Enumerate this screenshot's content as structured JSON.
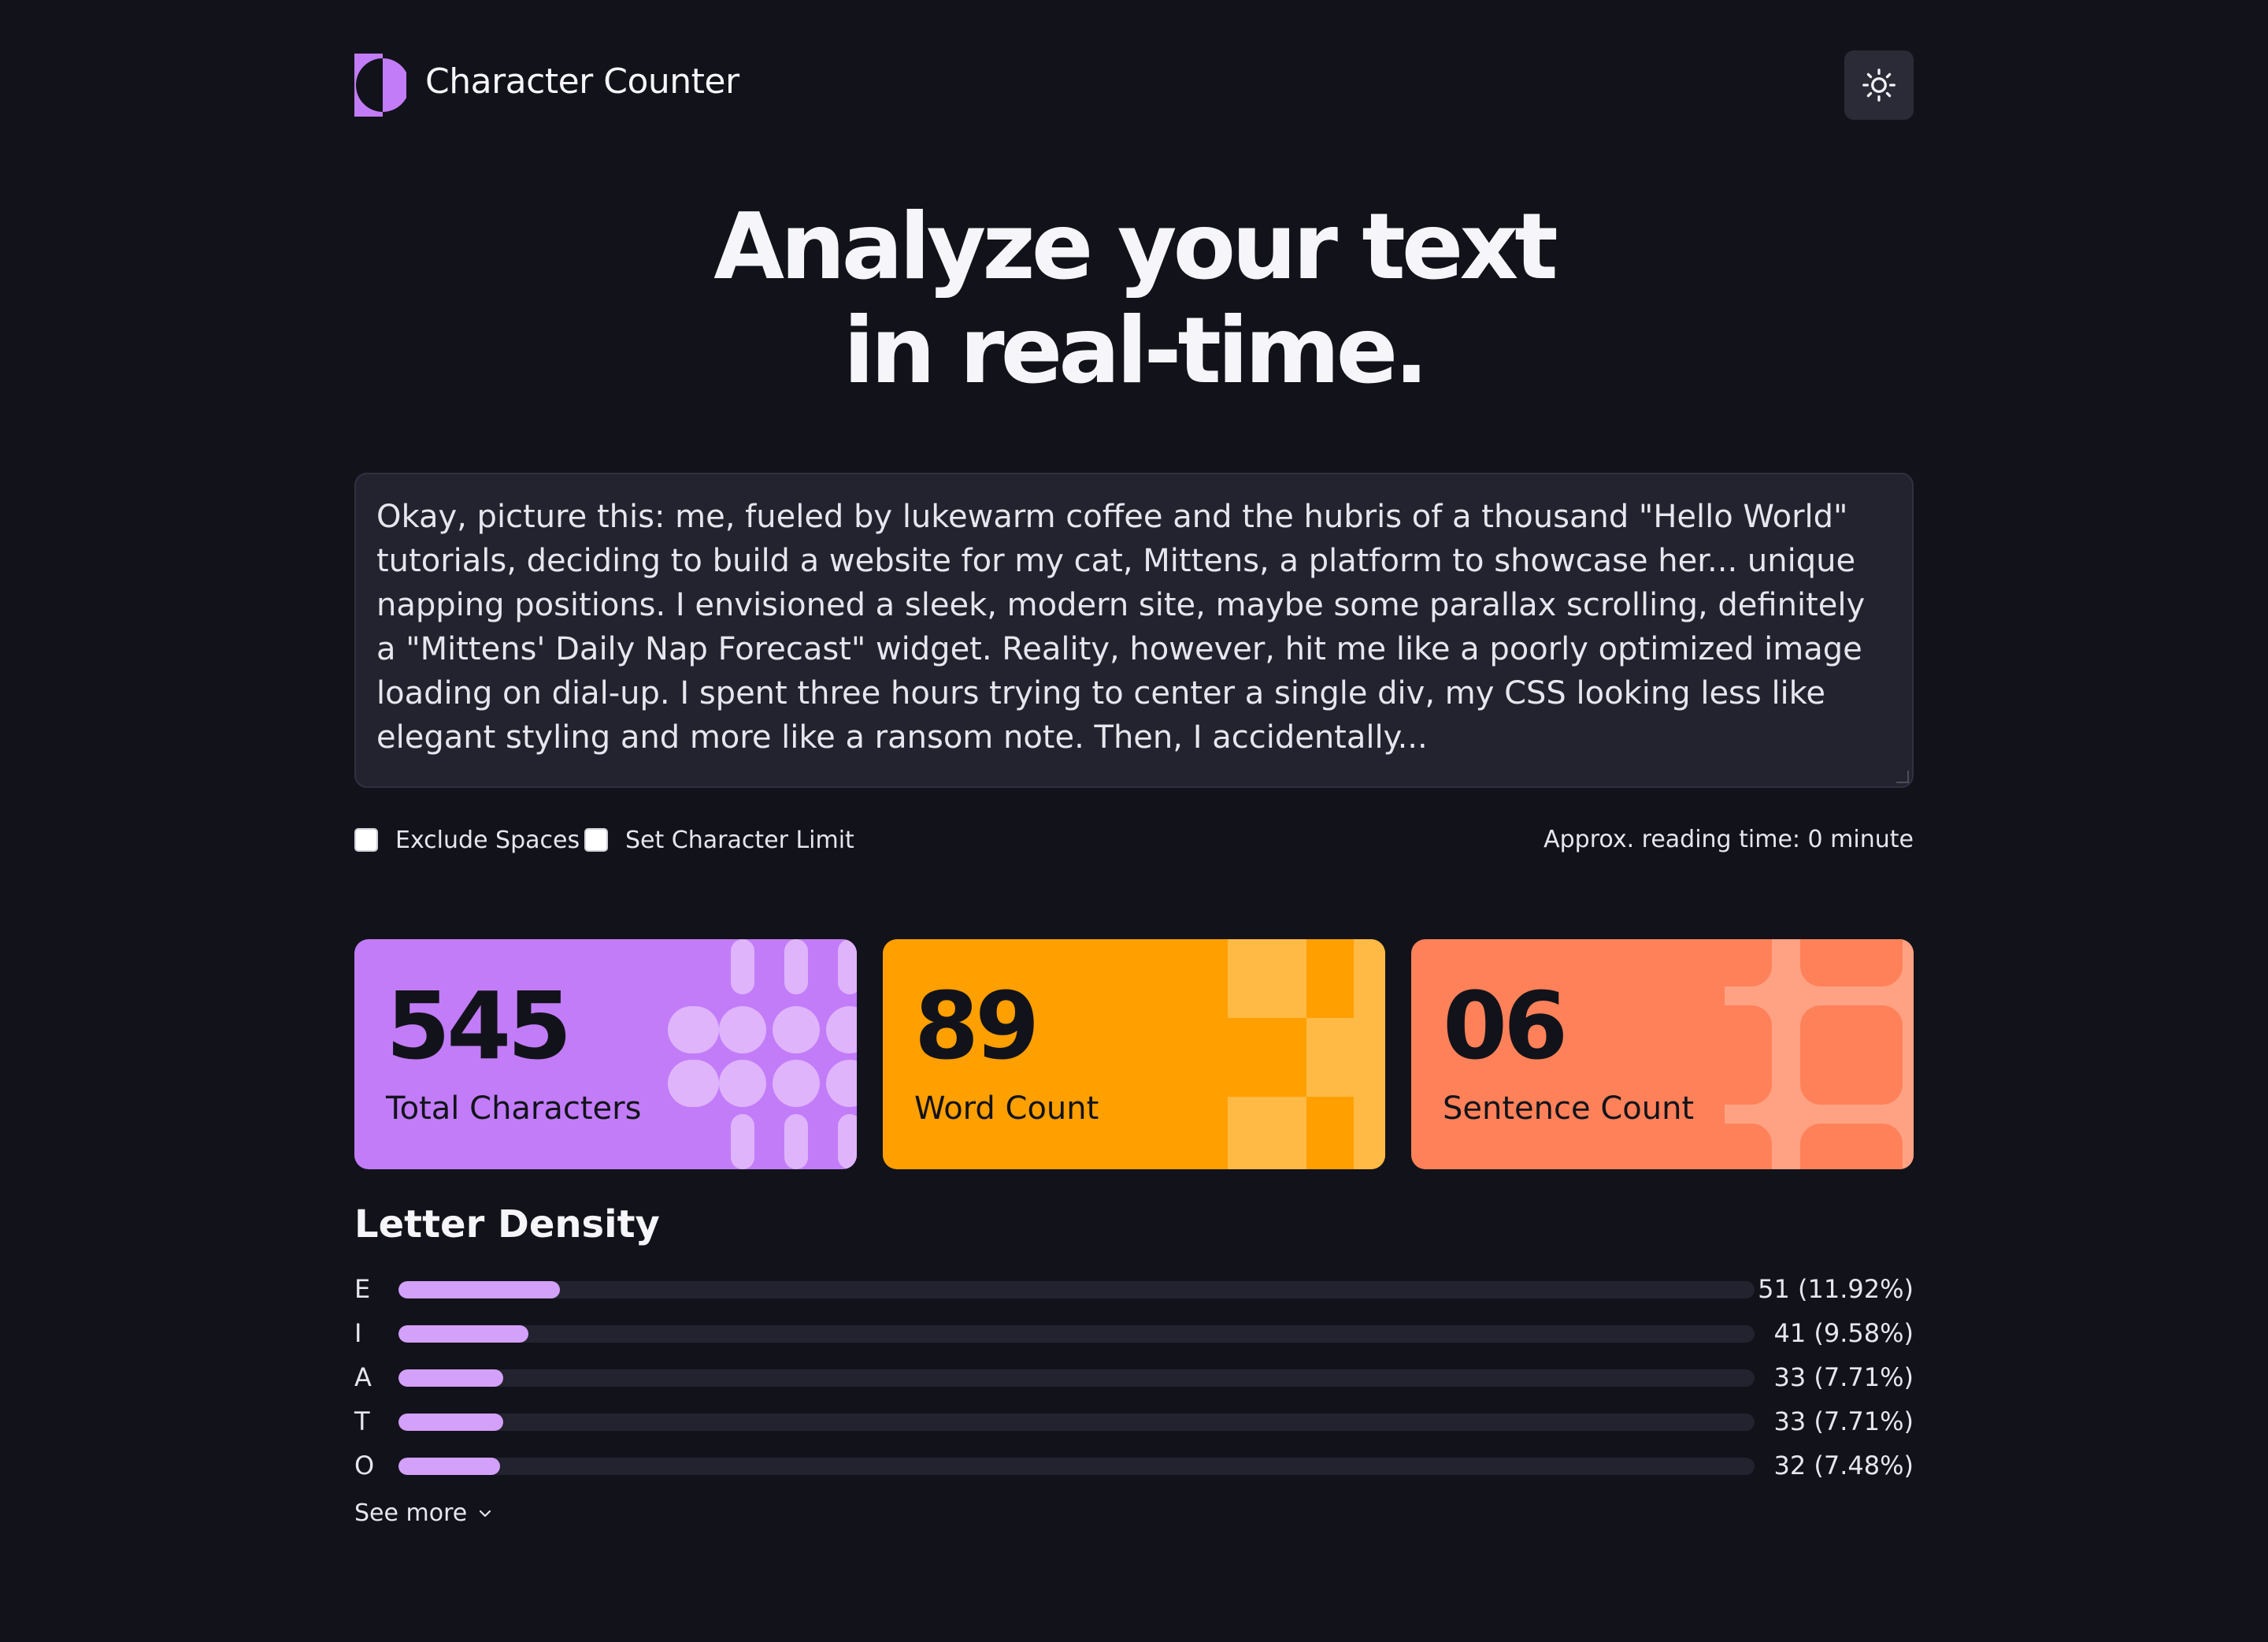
{
  "header": {
    "title": "Character Counter",
    "logo_icon": "half-circle-logo-icon",
    "theme_toggle_icon": "sun-icon"
  },
  "hero": {
    "line1": "Analyze your text",
    "line2": "in real-time."
  },
  "editor": {
    "text": "Okay, picture this: me, fueled by lukewarm coffee and the hubris of a thousand \"Hello World\" tutorials, deciding to build a website for my cat, Mittens, a platform to showcase her... unique napping positions. I envisioned a sleek, modern site, maybe some parallax scrolling, definitely a \"Mittens' Daily Nap Forecast\" widget. Reality, however, hit me like a poorly optimized image loading on dial-up. I spent three hours trying to center a single div, my CSS looking less like elegant styling and more like a ransom note. Then, I accidentally..."
  },
  "options": {
    "exclude_spaces": "Exclude Spaces",
    "char_limit": "Set Character Limit",
    "reading_time": "Approx. reading time: 0 minute"
  },
  "stats": {
    "total_characters": {
      "value": "545",
      "label": "Total Characters",
      "color": "#c27cf8"
    },
    "word_count": {
      "value": "89",
      "label": "Word Count",
      "color": "#ff9f00"
    },
    "sentence_count": {
      "value": "06",
      "label": "Sentence Count",
      "color": "#fe8159"
    }
  },
  "density": {
    "title": "Letter Density",
    "rows": [
      {
        "letter": "E",
        "value": "51 (11.92%)",
        "percent": 11.92
      },
      {
        "letter": "I",
        "value": "41 (9.58%)",
        "percent": 9.58
      },
      {
        "letter": "A",
        "value": "33 (7.71%)",
        "percent": 7.71
      },
      {
        "letter": "T",
        "value": "33 (7.71%)",
        "percent": 7.71
      },
      {
        "letter": "O",
        "value": "32 (7.48%)",
        "percent": 7.48
      }
    ],
    "see_more": "See more",
    "bar_color": "#d3a0fa"
  }
}
